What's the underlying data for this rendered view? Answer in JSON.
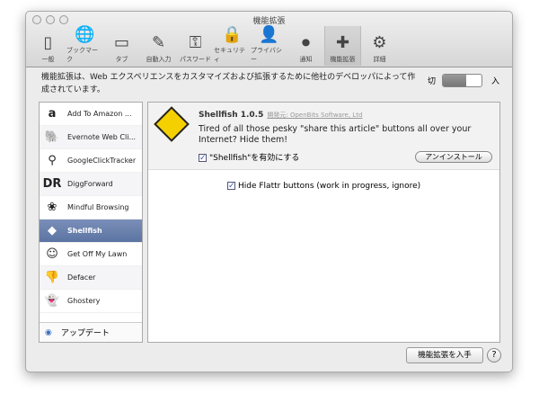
{
  "window": {
    "title": "機能拡張"
  },
  "toolbar": [
    {
      "label": "一般",
      "icon": "switch-icon",
      "glyph": "▯"
    },
    {
      "label": "ブックマーク",
      "icon": "globe-icon",
      "glyph": "🌐"
    },
    {
      "label": "タブ",
      "icon": "tab-icon",
      "glyph": "▭"
    },
    {
      "label": "自動入力",
      "icon": "pencil-icon",
      "glyph": "✎"
    },
    {
      "label": "パスワード",
      "icon": "key-icon",
      "glyph": "⚿"
    },
    {
      "label": "セキュリティ",
      "icon": "lock-icon",
      "glyph": "🔒"
    },
    {
      "label": "プライバシー",
      "icon": "person-icon",
      "glyph": "👤"
    },
    {
      "label": "通知",
      "icon": "record-icon",
      "glyph": "⏺"
    },
    {
      "label": "機能拡張",
      "icon": "puzzle-icon",
      "glyph": "✚"
    },
    {
      "label": "詳細",
      "icon": "gear-icon",
      "glyph": "⚙"
    }
  ],
  "description": "機能拡張は、Web エクスペリエンスをカスタマイズおよび拡張するために他社のデベロッパによって作成されています。",
  "switch": {
    "off_label": "切",
    "on_label": "入",
    "state": "off"
  },
  "extensions": [
    {
      "name": "Add To Amazon ...",
      "glyph": "a"
    },
    {
      "name": "Evernote Web Cli...",
      "glyph": "🐘"
    },
    {
      "name": "GoogleClickTracker",
      "glyph": "⚲"
    },
    {
      "name": "DiggForward",
      "glyph": "DR"
    },
    {
      "name": "Mindful Browsing",
      "glyph": "❀"
    },
    {
      "name": "Shellfish",
      "glyph": "◆"
    },
    {
      "name": "Get Off My Lawn",
      "glyph": "☺"
    },
    {
      "name": "Defacer",
      "glyph": "👎"
    },
    {
      "name": "Ghostery",
      "glyph": "👻"
    }
  ],
  "update_label": "アップデート",
  "detail": {
    "name": "Shellfish 1.0.5",
    "developer": "開発元: OpenBits Software, Ltd",
    "description": "Tired of all those pesky \"share this article\" buttons all over your Internet? Hide them!",
    "enable_label": "\"Shellfish\"を有効にする",
    "uninstall_label": "アンインストール",
    "option_label": "Hide Flattr buttons (work in progress, ignore)"
  },
  "get_extensions_label": "機能拡張を入手",
  "help_label": "?"
}
